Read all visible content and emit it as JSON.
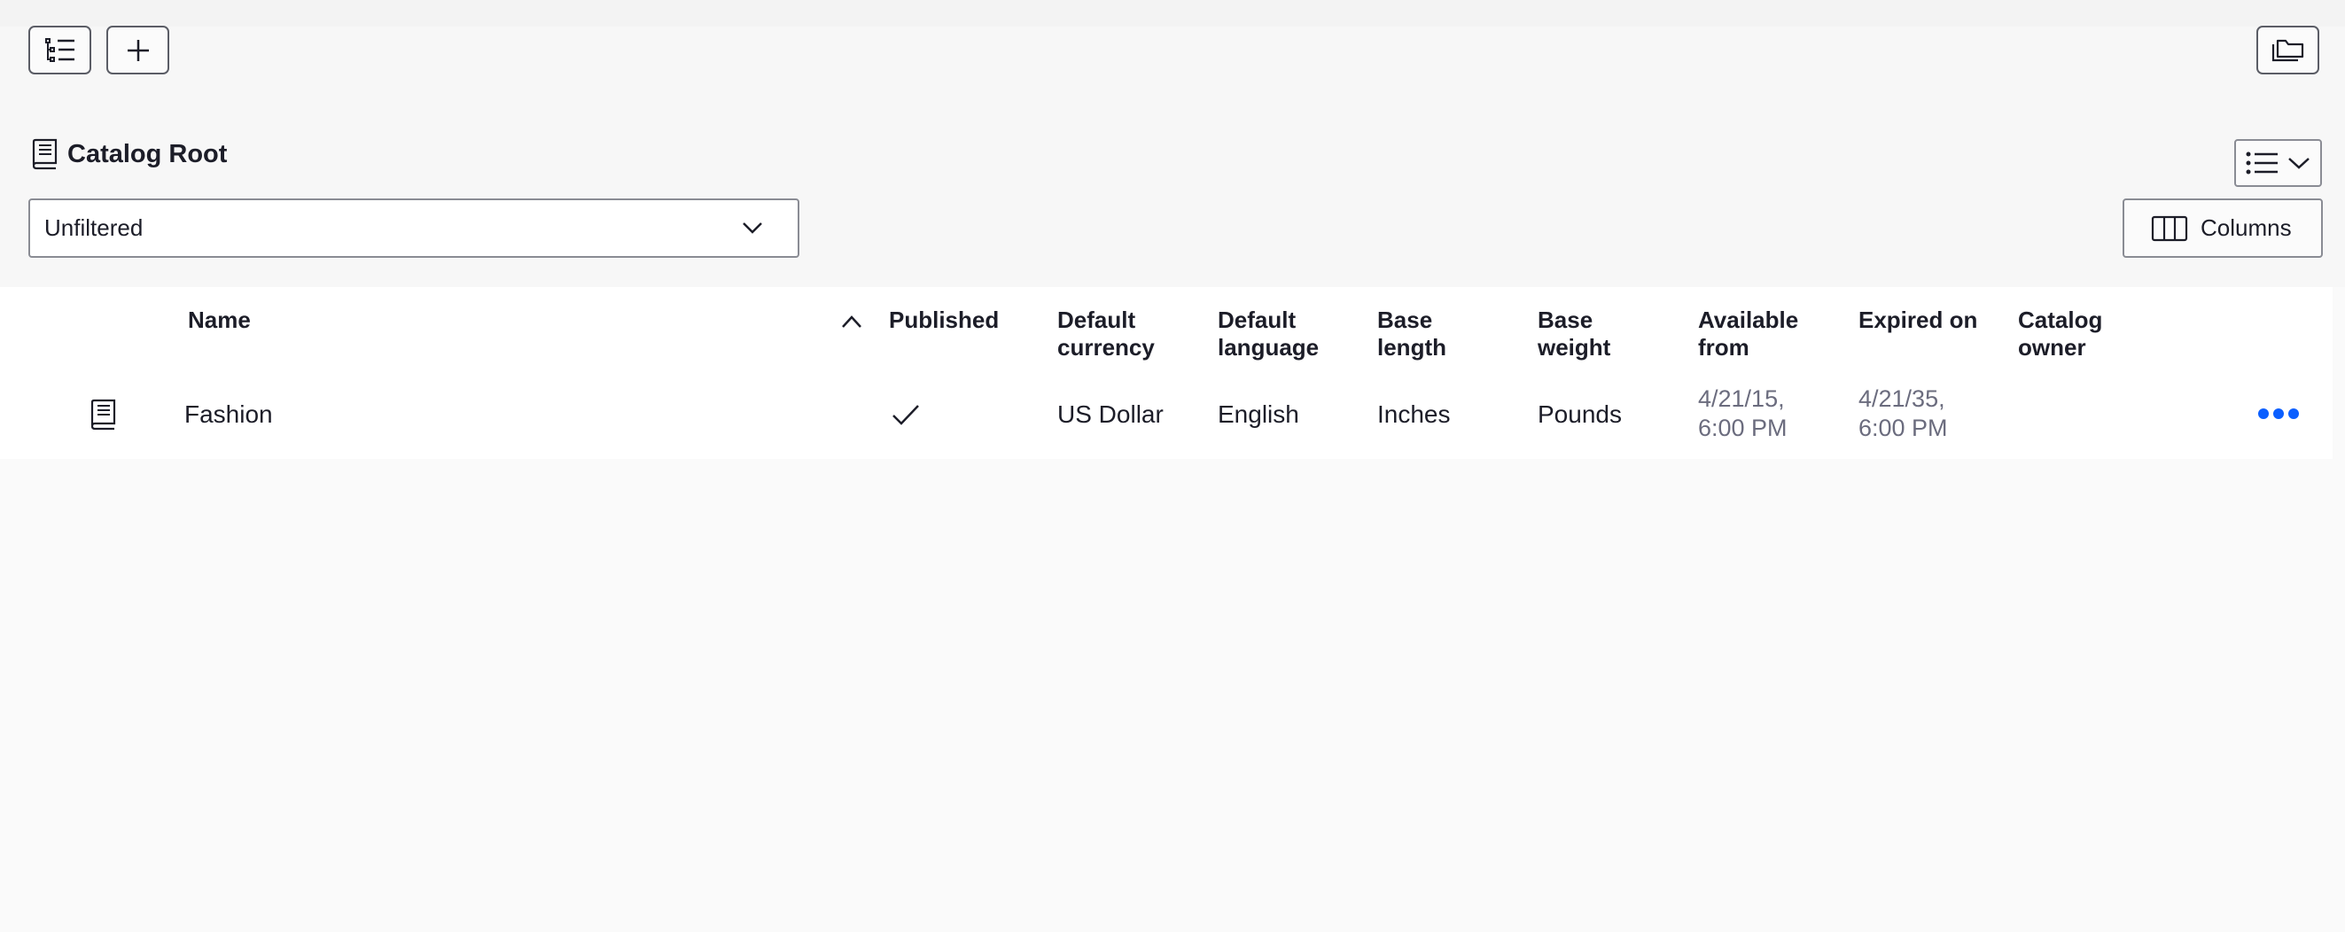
{
  "toolbar": {
    "tree_view_icon": "tree-list-icon",
    "add_icon": "plus-icon",
    "folder_icon": "folders-icon"
  },
  "page": {
    "title": "Catalog Root",
    "title_icon": "book-icon",
    "view_toggle_icon": "list-view-icon"
  },
  "filter": {
    "selected": "Unfiltered"
  },
  "columns_button": {
    "label": "Columns"
  },
  "table": {
    "headers": {
      "name": "Name",
      "published": "Published",
      "currency_1": "Default",
      "currency_2": "currency",
      "language_1": "Default",
      "language_2": "language",
      "length_1": "Base",
      "length_2": "length",
      "weight_1": "Base",
      "weight_2": "weight",
      "available_1": "Available",
      "available_2": "from",
      "expired": "Expired on",
      "owner_1": "Catalog",
      "owner_2": "owner"
    },
    "rows": [
      {
        "name": "Fashion",
        "published": true,
        "currency": "US Dollar",
        "language": "English",
        "length": "Inches",
        "weight": "Pounds",
        "available_date": "4/21/15,",
        "available_time": "6:00 PM",
        "expired_date": "4/21/35,",
        "expired_time": "6:00 PM",
        "owner": ""
      }
    ]
  },
  "colors": {
    "accent": "#0b5fff",
    "text": "#1c1d28",
    "muted": "#6b6c7e"
  }
}
